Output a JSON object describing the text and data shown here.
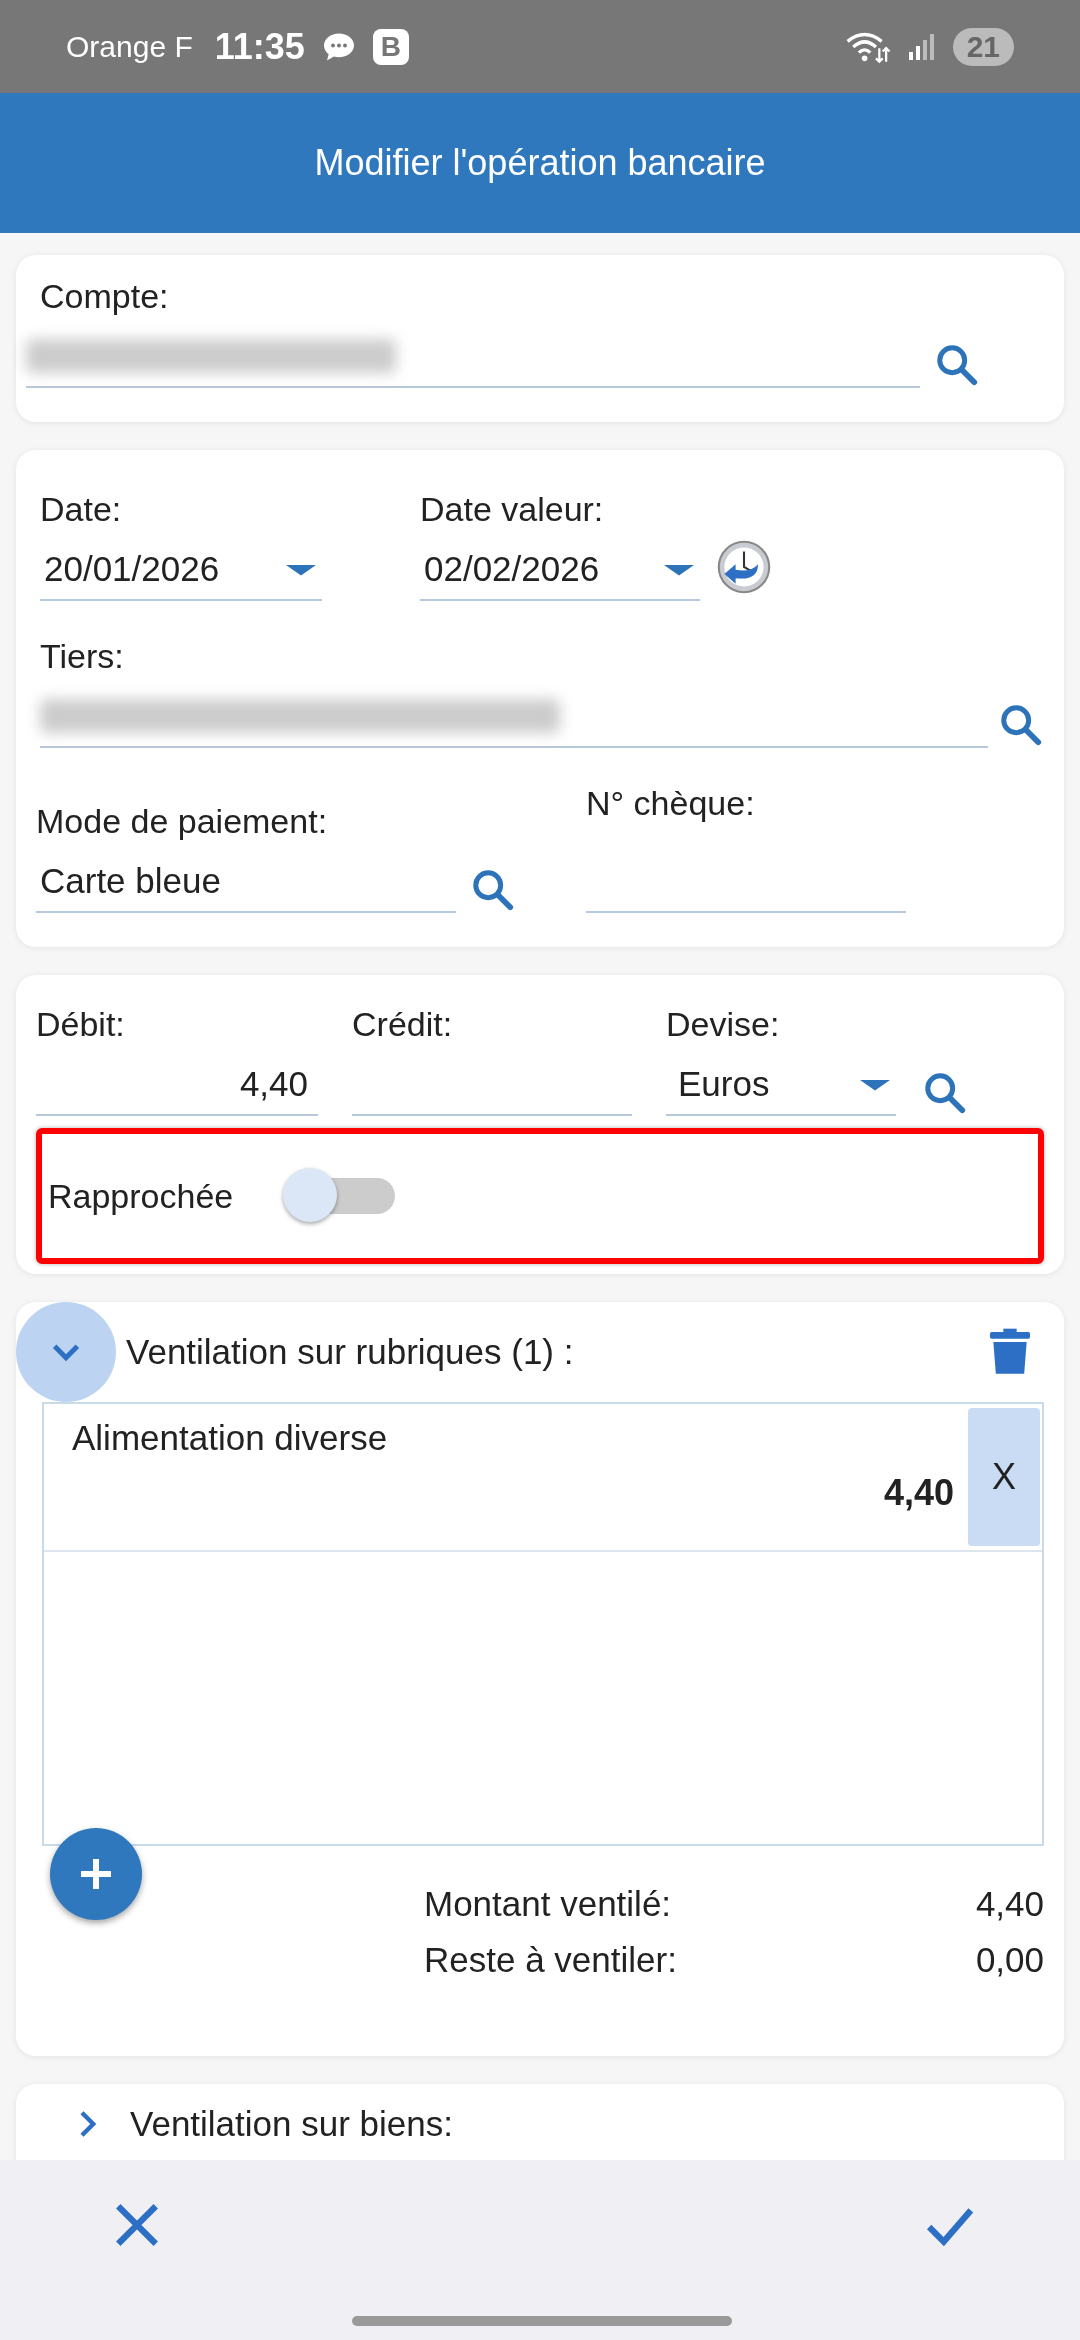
{
  "status_bar": {
    "carrier": "Orange F",
    "time": "11:35",
    "badge": "B",
    "battery": "21"
  },
  "header": {
    "title": "Modifier l'opération bancaire"
  },
  "account": {
    "label": "Compte:",
    "value_redacted": true
  },
  "dates": {
    "date_label": "Date:",
    "date": "20/01/2026",
    "value_date_label": "Date valeur:",
    "value_date": "02/02/2026"
  },
  "payee": {
    "label": "Tiers:",
    "value_redacted": true
  },
  "payment": {
    "mode_label": "Mode de paiement:",
    "mode": "Carte bleue",
    "cheque_label": "N° chèque:"
  },
  "amounts": {
    "debit_label": "Débit:",
    "debit": "4,40",
    "credit_label": "Crédit:",
    "currency_label": "Devise:",
    "currency": "Euros"
  },
  "reconciled": {
    "label": "Rapprochée",
    "on": false,
    "highlighted": true
  },
  "categories": {
    "title": "Ventilation sur rubriques (1) :",
    "expanded": true,
    "items": [
      {
        "name": "Alimentation diverse",
        "amount": "4,40",
        "remove": "X"
      }
    ],
    "summary": [
      {
        "label": "Montant ventilé:",
        "value": "4,40"
      },
      {
        "label": "Reste à ventiler:",
        "value": "0,00"
      }
    ]
  },
  "assets": {
    "title": "Ventilation sur biens:",
    "expanded": false
  }
}
